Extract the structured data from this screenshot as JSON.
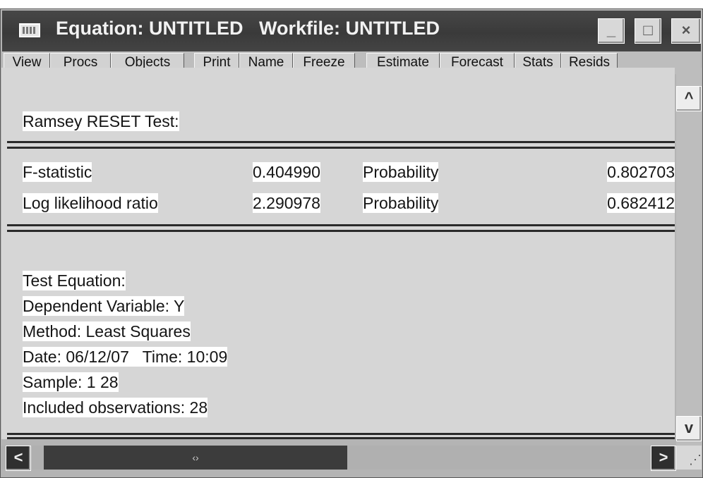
{
  "window": {
    "title": "Equation: UNTITLED   Workfile: UNTITLED",
    "icon": "eviews-window-icon",
    "controls": {
      "minimize": "_",
      "maximize": "□",
      "close": "×"
    }
  },
  "toolbar": {
    "buttons": [
      "View",
      "Procs",
      "Objects",
      "Print",
      "Name",
      "Freeze",
      "Estimate",
      "Forecast",
      "Stats",
      "Resids"
    ]
  },
  "output": {
    "heading": "Ramsey RESET Test:",
    "stats": [
      {
        "label": "F-statistic",
        "value": "0.404990",
        "prob_label": "Probability",
        "prob": "0.802703"
      },
      {
        "label": "Log likelihood ratio",
        "value": "2.290978",
        "prob_label": "Probability",
        "prob": "0.682412"
      }
    ],
    "info": [
      "Test Equation:",
      "Dependent Variable: Y",
      "Method: Least Squares",
      "Date: 06/12/07   Time: 10:09",
      "Sample: 1 28",
      "Included observations: 28"
    ]
  },
  "scrollbar": {
    "up_icon": "^",
    "down_icon": "v",
    "left_icon": "<",
    "right_icon": ">",
    "thumb_grip": "‹›",
    "size_grip": "⋰"
  }
}
